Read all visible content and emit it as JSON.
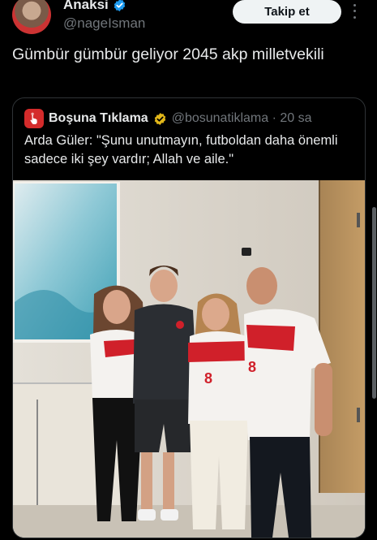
{
  "tweet": {
    "display_name": "Anaksi",
    "handle": "@nageIsman",
    "follow_label": "Takip et",
    "text": "Gümbür gümbür geliyor 2045 akp milletvekili"
  },
  "quote": {
    "display_name": "Boşuna Tıklama",
    "handle": "@bosunatiklama · 20 sa",
    "text": "Arda Güler: \"Şunu unutmayın, futboldan daha önemli sadece iki şey vardır; Allah ve aile.\""
  },
  "colors": {
    "background": "#000000",
    "verified_blue": "#1d9bf0",
    "verified_gold": "#e2b719",
    "logo_red": "#d42b2b",
    "jersey_red": "#d0202a"
  },
  "icons": {
    "verified": "verified-badge-icon",
    "gold_verified": "gold-verified-badge-icon",
    "more": "more-options-icon",
    "logo": "cursor-click-logo-icon"
  }
}
